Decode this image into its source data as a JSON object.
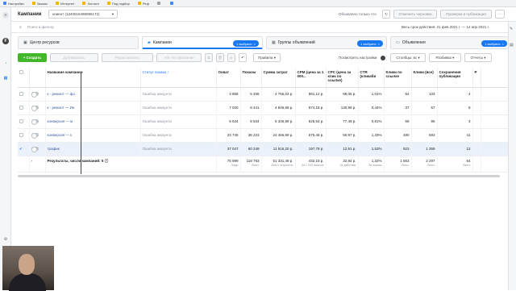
{
  "bookmarks": [
    "Настройки",
    "Заказы",
    "Интернет",
    "Хостинг",
    "Под подбор",
    "Реф",
    "",
    ""
  ],
  "header": {
    "title": "Кампании",
    "account": "клиент (1340616499095172)",
    "status": "Обновлено только что",
    "discard_label": "Отменить черновик",
    "review_label": "Проверка и публикация"
  },
  "search": {
    "placeholder": "Поиск и фильтр",
    "date_range": "Весь срок действия: 21 фев 2021 г. — 14 апр 2021 г."
  },
  "tabs": [
    {
      "label": "Центр ресурсов",
      "pill": ""
    },
    {
      "label": "Кампании",
      "pill": "1 выбрано"
    },
    {
      "label": "Группы объявлений",
      "pill": "1 выбрано"
    },
    {
      "label": "Объявления",
      "pill": "1 выбрано"
    }
  ],
  "toolbar": {
    "create": "+ Создать",
    "duplicate": "Дублировать",
    "edit": "Редактировать",
    "ab_test": "A/B-тестирование",
    "rules": "Правила",
    "view_setup": "Посмотреть настройки",
    "columns": "Столбцы: вс",
    "breakdown": "Разбивка",
    "reports": "Отчеты"
  },
  "table": {
    "headers": [
      "Название кампании",
      "Статус показа ↑",
      "Охват",
      "Показы",
      "Сумма затрат",
      "CPM (цена за 1 000...",
      "CPC (цена за клик по ссылке)",
      "CTR (кликаби",
      "Клики по ссылке",
      "Клики (все)",
      "Сохранения публикации",
      "Р"
    ],
    "rows": [
      {
        "name": "к - ремонт — фо",
        "status": "Ошибка аккаунта",
        "reach": "3 858",
        "impressions": "5 336",
        "spent": "4 755,03 р.",
        "cpm": "891,12 р.",
        "cpc": "88,06 р.",
        "ctr": "1,01%",
        "link_clicks": "54",
        "clicks": "103",
        "saves": "4"
      },
      {
        "name": "к - ремонт — Ин",
        "status": "Ошибка аккаунта",
        "reach": "7 020",
        "impressions": "8 441",
        "spent": "4 846,68 р.",
        "cpm": "574,18 р.",
        "cpc": "130,99 р.",
        "ctr": "0,44%",
        "link_clicks": "37",
        "clicks": "57",
        "saves": "8"
      },
      {
        "name": "конверсия — м",
        "status": "Ошибка аккаунта",
        "reach": "6 534",
        "impressions": "8 534",
        "spent": "5 346,89 р.",
        "cpm": "626,54 р.",
        "cpc": "77,49 р.",
        "ctr": "0,81%",
        "link_clicks": "69",
        "clicks": "95",
        "saves": "3"
      },
      {
        "name": "конверсия — к",
        "status": "Ошибка аккаунта",
        "reach": "23 745",
        "impressions": "36 223",
        "spent": "24 466,69 р.",
        "cpm": "675,45 р.",
        "cpc": "50,97 р.",
        "ctr": "1,33%",
        "link_clicks": "480",
        "clicks": "683",
        "saves": "41"
      },
      {
        "name": "трафик",
        "status": "Ошибка аккаунта",
        "reach": "37 047",
        "impressions": "60 249",
        "spent": "11 916,20 р.",
        "cpm": "197,78 р.",
        "cpc": "12,91 р.",
        "ctr": "1,53%",
        "link_clicks": "923",
        "clicks": "1 359",
        "saves": "12"
      }
    ],
    "totals": {
      "label": "Результаты, число кампаний: 5",
      "reach": "75 999",
      "reach_sub": "Люди",
      "impressions": "118 783",
      "impressions_sub": "Всего",
      "spent": "51 331,49 р.",
      "spent_sub": "Всего потрачено",
      "cpm": "432,15 р.",
      "cpm_sub": "За 1 000 показов",
      "cpc": "32,84 р.",
      "cpc_sub": "За действие",
      "ctr": "1,32%",
      "ctr_sub": "За показы",
      "link_clicks": "1 563",
      "link_clicks_sub": "Всего",
      "clicks": "2 297",
      "clicks_sub": "Всего",
      "saves": "64",
      "saves_sub": "Всего"
    }
  }
}
